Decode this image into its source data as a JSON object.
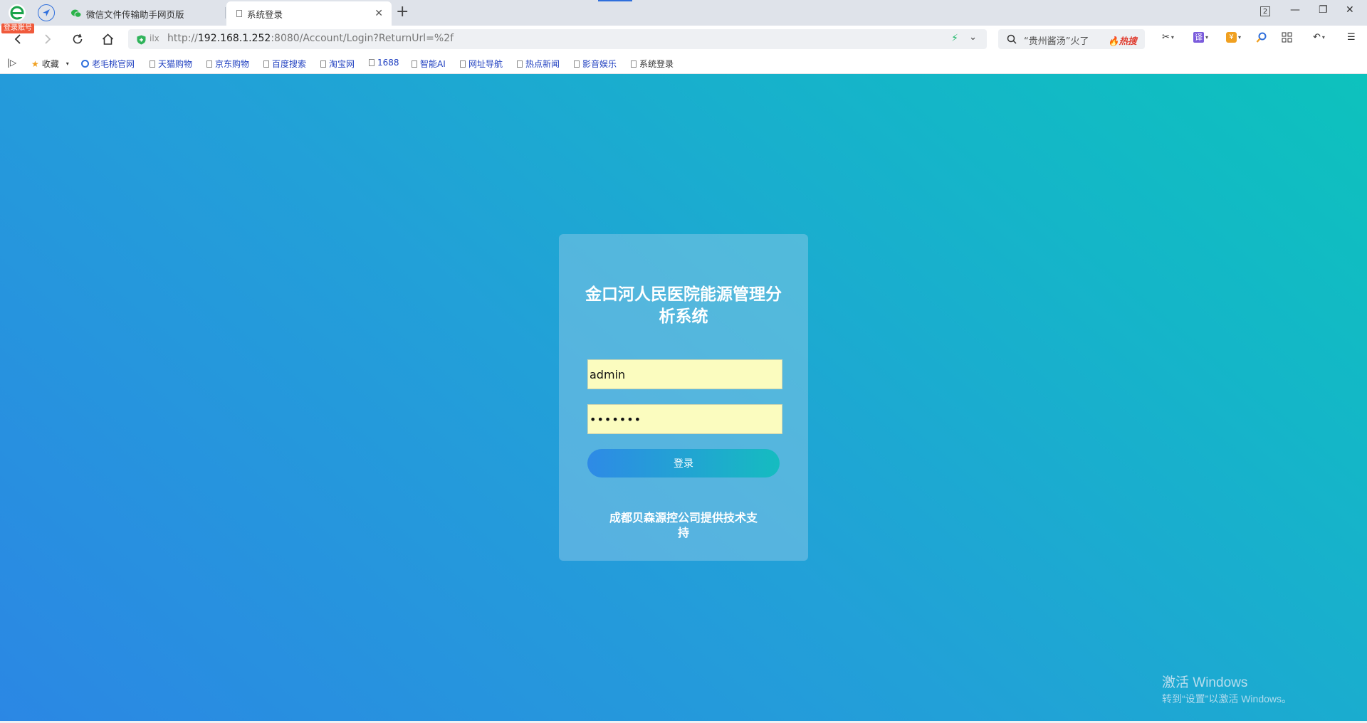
{
  "browser": {
    "logo_badge": "登录账号",
    "tabs": [
      {
        "title": "微信文件传输助手网页版",
        "active": false
      },
      {
        "title": "系统登录",
        "active": true
      }
    ],
    "new_tab_label": "+",
    "window_count": "2",
    "address": {
      "url_prefix": "http://",
      "url_host": "192.168.1.252",
      "url_rest": ":8080/Account/Login?ReturnUrl=%2f"
    },
    "search": {
      "text": "“贵州酱汤”火了",
      "hot_label": "热搜"
    },
    "bookmarks": [
      {
        "label": "收藏",
        "icon": "star-icon"
      },
      {
        "label": "老毛桃官网",
        "icon": "globe-icon"
      },
      {
        "label": "天猫购物",
        "icon": "doc-icon"
      },
      {
        "label": "京东购物",
        "icon": "doc-icon"
      },
      {
        "label": "百度搜索",
        "icon": "doc-icon"
      },
      {
        "label": "淘宝网",
        "icon": "doc-icon"
      },
      {
        "label": "1688",
        "icon": "doc-icon"
      },
      {
        "label": "智能AI",
        "icon": "doc-icon"
      },
      {
        "label": "网址导航",
        "icon": "doc-icon"
      },
      {
        "label": "热点新闻",
        "icon": "doc-icon"
      },
      {
        "label": "影音娱乐",
        "icon": "doc-icon"
      },
      {
        "label": "系统登录",
        "icon": "doc-icon"
      }
    ],
    "translate_glyph": "译"
  },
  "login": {
    "title": "金口河人民医院能源管理分析系统",
    "username_value": "admin",
    "password_value": "•••••••",
    "button_label": "登录",
    "support_text": "成都贝森源控公司提供技术支持"
  },
  "watermark": {
    "line1": "激活 Windows",
    "line2": "转到“设置”以激活 Windows。"
  },
  "colors": {
    "page_gradient_start": "#2b87e4",
    "page_gradient_end": "#0dc2bd",
    "input_background": "#fbfcbf",
    "button_gradient_start": "#2e8ae6",
    "button_gradient_end": "#15bcc0"
  }
}
